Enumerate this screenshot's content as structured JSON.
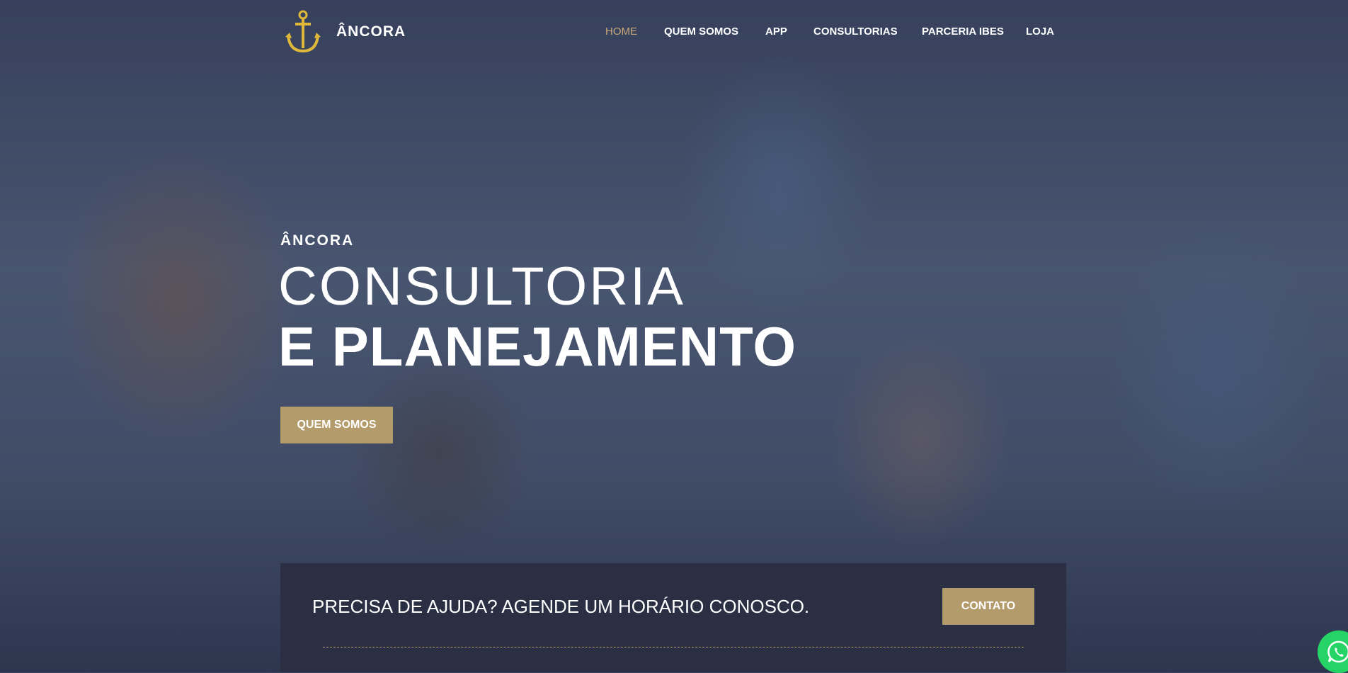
{
  "brand": {
    "name": "ÂNCORA",
    "logo_icon": "anchor-icon",
    "accent": "#b49b6c"
  },
  "nav": {
    "items": [
      {
        "label": "HOME",
        "active": true
      },
      {
        "label": "QUEM SOMOS",
        "active": false
      },
      {
        "label": "APP",
        "active": false
      },
      {
        "label": "CONSULTORIAS",
        "active": false
      },
      {
        "label": "PARCERIA IBES",
        "active": false
      },
      {
        "label": "LOJA",
        "active": false
      }
    ]
  },
  "hero": {
    "eyebrow": "ÂNCORA",
    "headline_line1": "CONSULTORIA",
    "headline_line2": "E PLANEJAMENTO",
    "button_label": "QUEM SOMOS"
  },
  "cta": {
    "text": "PRECISA DE AJUDA? AGENDE UM HORÁRIO CONOSCO.",
    "button_label": "CONTATO"
  },
  "whatsapp": {
    "icon": "whatsapp-icon",
    "color": "#25d366"
  }
}
